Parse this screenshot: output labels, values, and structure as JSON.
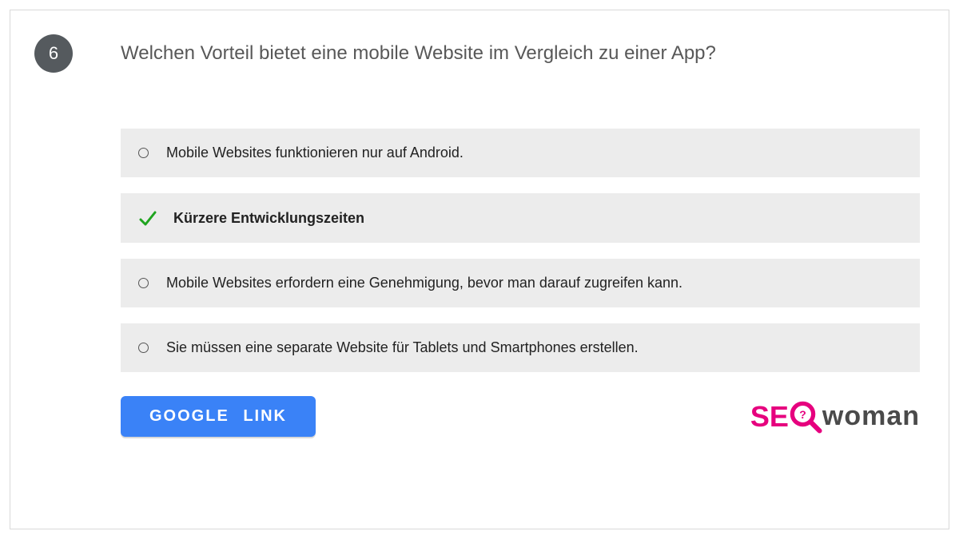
{
  "question": {
    "number": "6",
    "text": "Welchen Vorteil bietet eine mobile Website im Vergleich zu einer App?"
  },
  "answers": [
    {
      "label": "Mobile Websites funktionieren nur auf Android.",
      "correct": false
    },
    {
      "label": "Kürzere Entwicklungszeiten",
      "correct": true
    },
    {
      "label": "Mobile Websites erfordern eine Genehmigung, bevor man darauf zugreifen kann.",
      "correct": false
    },
    {
      "label": "Sie müssen eine separate Website für Tablets und Smartphones erstellen.",
      "correct": false
    }
  ],
  "button": {
    "label": "GOOGLE LINK"
  },
  "logo": {
    "part1": "SE",
    "part2": "woman"
  },
  "colors": {
    "accent": "#3a82f7",
    "brand": "#e6007e",
    "correct": "#1fa41f"
  }
}
